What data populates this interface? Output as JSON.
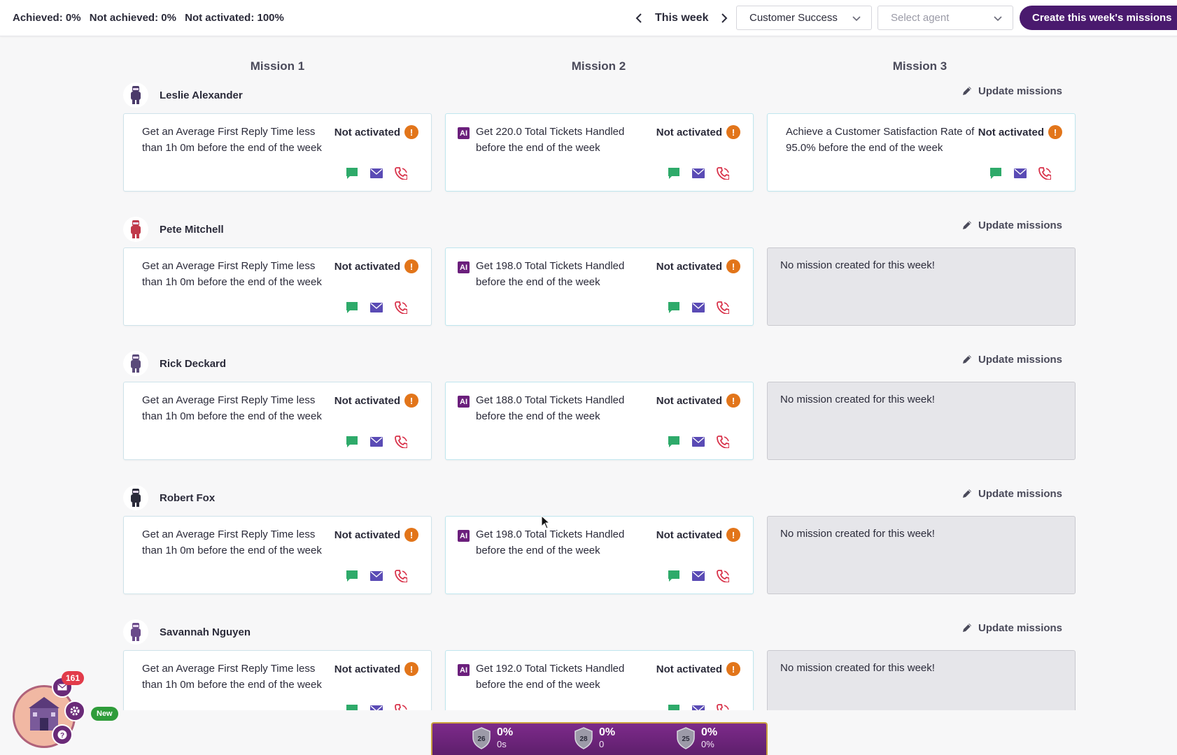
{
  "header": {
    "achieved_label": "Achieved:",
    "achieved_value": "0%",
    "not_achieved_label": "Not achieved:",
    "not_achieved_value": "0%",
    "not_activated_label": "Not activated:",
    "not_activated_value": "100%",
    "week_label": "This week",
    "team_select": "Customer Success",
    "agent_select_placeholder": "Select agent",
    "create_button": "Create this week's missions"
  },
  "columns": [
    "Mission 1",
    "Mission 2",
    "Mission 3"
  ],
  "update_label": "Update missions",
  "status_label": "Not activated",
  "ai_badge": "AI",
  "empty_text": "No mission created for this week!",
  "agents": [
    {
      "name": "Leslie Alexander",
      "m1": "Get an Average First Reply Time less than 1h 0m before the end of the week",
      "m2": "Get 220.0 Total Tickets Handled before the end of the week",
      "m3": "Achieve a Customer Satisfaction Rate of 95.0% before the end of the week"
    },
    {
      "name": "Pete Mitchell",
      "m1": "Get an Average First Reply Time less than 1h 0m before the end of the week",
      "m2": "Get 198.0 Total Tickets Handled before the end of the week",
      "m3": null
    },
    {
      "name": "Rick Deckard",
      "m1": "Get an Average First Reply Time less than 1h 0m before the end of the week",
      "m2": "Get 188.0 Total Tickets Handled before the end of the week",
      "m3": null
    },
    {
      "name": "Robert Fox",
      "m1": "Get an Average First Reply Time less than 1h 0m before the end of the week",
      "m2": "Get 198.0 Total Tickets Handled before the end of the week",
      "m3": null
    },
    {
      "name": "Savannah Nguyen",
      "m1": "Get an Average First Reply Time less than 1h 0m before the end of the week",
      "m2": "Get 192.0 Total Tickets Handled before the end of the week",
      "m3": null
    }
  ],
  "bottom_stats": [
    {
      "rank": "26",
      "percent": "0%",
      "value": "0s"
    },
    {
      "rank": "28",
      "percent": "0%",
      "value": "0"
    },
    {
      "rank": "25",
      "percent": "0%",
      "value": "0%"
    }
  ],
  "widget": {
    "notification_count": "161",
    "new_label": "New"
  },
  "colors": {
    "primary": "#4a1a6e",
    "warning": "#e2751a",
    "chat": "#2eaa6a",
    "email": "#5a4bb5",
    "phone": "#d8324a"
  },
  "icons": {
    "chat": "chat-icon",
    "email": "email-icon",
    "phone": "phone-icon",
    "warning": "warning-icon",
    "pencil": "pencil-icon"
  }
}
